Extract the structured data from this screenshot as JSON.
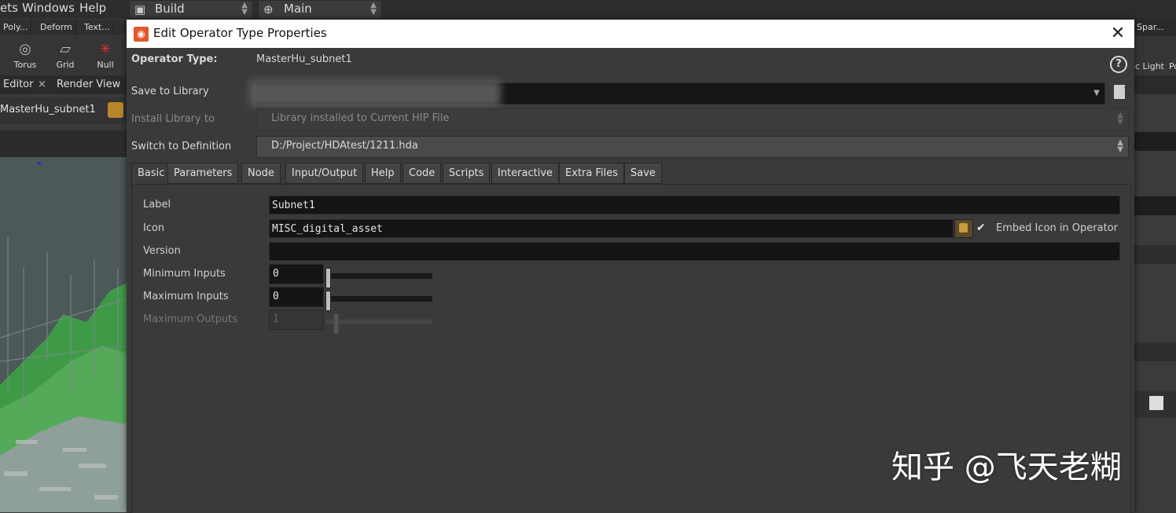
{
  "menubar": {
    "items": [
      "ets",
      "Windows",
      "Help"
    ],
    "desktop_label": "Build",
    "pane_label": "Main"
  },
  "shelf": {
    "tabs": [
      "Poly...",
      "Deform",
      "Text..."
    ],
    "tools": [
      "Torus",
      "Grid",
      "Null"
    ]
  },
  "panes": {
    "tabs": [
      "Editor",
      "Render View"
    ],
    "tab_close_glyph": "×",
    "path": "MasterHu_subnet1"
  },
  "right_panel": {
    "shelf_tab": "Spar...",
    "tools": [
      "c Light",
      "Po"
    ]
  },
  "dialog": {
    "title": "Edit Operator Type Properties",
    "close_glyph": "✕",
    "help_glyph": "?",
    "operator_type_label": "Operator Type:",
    "operator_type_value": "MasterHu_subnet1",
    "save_to_library_label": "Save to Library",
    "install_library_label": "Install Library to",
    "install_library_value": "Library installed to Current HIP File",
    "switch_definition_label": "Switch to Definition",
    "switch_definition_value": "D:/Project/HDAtest/1211.hda",
    "tabs": [
      "Basic",
      "Parameters",
      "Node",
      "Input/Output",
      "Help",
      "Code",
      "Scripts",
      "Interactive",
      "Extra Files",
      "Save"
    ],
    "active_tab": "Basic",
    "basic": {
      "label_label": "Label",
      "label_value": "Subnet1",
      "icon_label": "Icon",
      "icon_value": "MISC_digital_asset",
      "embed_icon_label": "Embed Icon in Operator",
      "embed_icon_checked": true,
      "version_label": "Version",
      "version_value": "",
      "min_inputs_label": "Minimum Inputs",
      "min_inputs_value": "0",
      "max_inputs_label": "Maximum Inputs",
      "max_inputs_value": "0",
      "max_outputs_label": "Maximum Outputs",
      "max_outputs_value": "1"
    }
  },
  "watermark": "知乎 @飞天老糊",
  "colors": {
    "dialog_bg": "#3a3a3a",
    "field_bg": "#141414",
    "title_bar": "#ffffff",
    "houdini_logo": "#e2582b"
  }
}
